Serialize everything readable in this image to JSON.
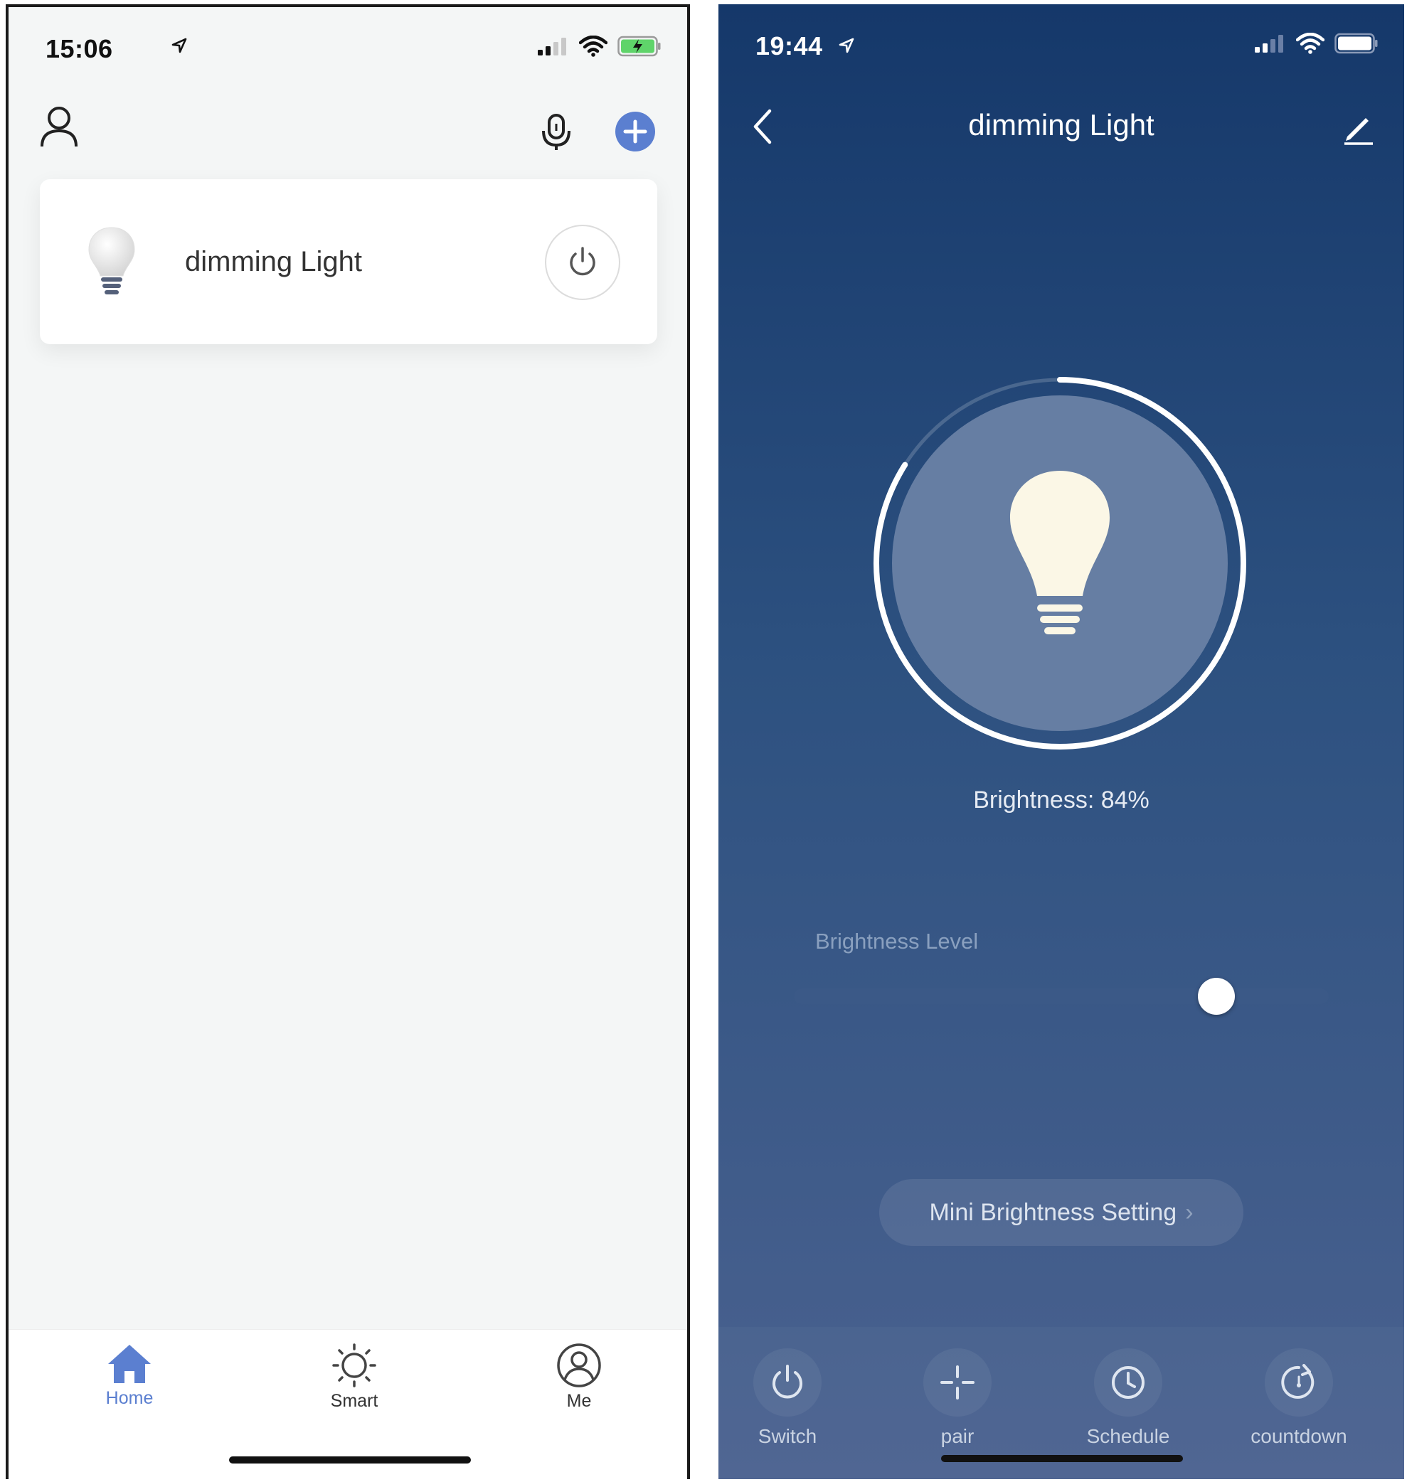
{
  "left": {
    "status_time": "15:06",
    "device": {
      "name": "dimming Light"
    },
    "tabs": [
      {
        "label": "Home",
        "active": true
      },
      {
        "label": "Smart",
        "active": false
      },
      {
        "label": "Me",
        "active": false
      }
    ]
  },
  "right": {
    "status_time": "19:44",
    "title": "dimming Light",
    "brightness_text": "Brightness: 84%",
    "brightness_level_label": "Brightness Level",
    "brightness_percent": 84,
    "slider_fraction": 0.79,
    "mini_brightness_label": "Mini Brightness Setting",
    "tabs": [
      {
        "label": "Switch"
      },
      {
        "label": "pair"
      },
      {
        "label": "Schedule"
      },
      {
        "label": "countdown"
      }
    ]
  },
  "colors": {
    "accent": "#5b7fd0",
    "right_bg_top": "#15386a",
    "right_bg_bottom": "#4b6290",
    "battery_green": "#5fd46a"
  }
}
